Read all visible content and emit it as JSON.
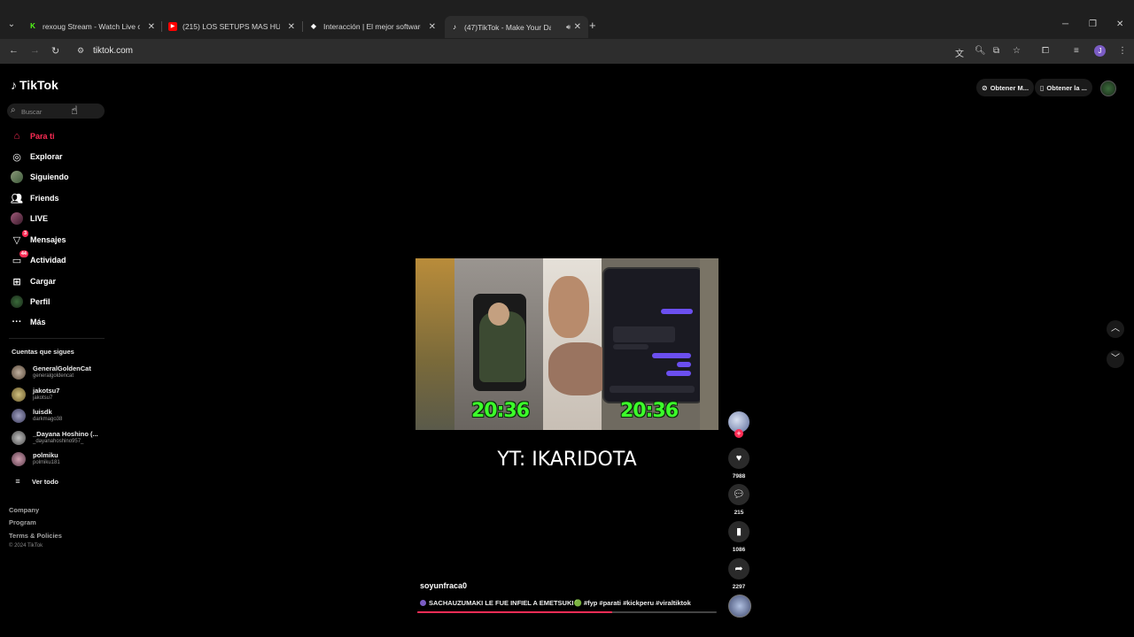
{
  "browser": {
    "tabs": [
      {
        "title": "rexoug Stream - Watch Live on",
        "favicon_color": "#53fc18",
        "favicon_letter": "K"
      },
      {
        "title": "(215) LOS SETUPS MAS HUMILD",
        "favicon_color": "#ff0000",
        "favicon_letter": "▶"
      },
      {
        "title": "Interacción | El mejor software",
        "favicon_color": "#ffffff",
        "favicon_letter": "◆"
      },
      {
        "title": "(47)TikTok - Make Your Day",
        "favicon_color": "#ffffff",
        "favicon_letter": "♪",
        "active": true
      }
    ],
    "url": "tiktok.com",
    "profile_letter": "J"
  },
  "sidebar": {
    "logo_text": "TikTok",
    "search_placeholder": "Buscar",
    "nav": [
      {
        "label": "Para ti",
        "icon": "home-icon",
        "active": true
      },
      {
        "label": "Explorar",
        "icon": "compass-icon"
      },
      {
        "label": "Siguiendo",
        "icon": "following-icon"
      },
      {
        "label": "Friends",
        "icon": "friends-icon"
      },
      {
        "label": "LIVE",
        "icon": "live-icon"
      },
      {
        "label": "Mensajes",
        "icon": "messages-icon",
        "badge": "3"
      },
      {
        "label": "Actividad",
        "icon": "activity-icon",
        "badge": "44"
      },
      {
        "label": "Cargar",
        "icon": "upload-icon"
      },
      {
        "label": "Perfil",
        "icon": "profile-icon"
      },
      {
        "label": "Más",
        "icon": "more-icon"
      }
    ],
    "following_title": "Cuentas que sigues",
    "following": [
      {
        "name": "GeneralGoldenCat",
        "handle": "generalgoldencat"
      },
      {
        "name": "jakotsu7",
        "handle": "jakotsu7"
      },
      {
        "name": "luisdk",
        "handle": "darkmago38"
      },
      {
        "name": "_Dayana Hoshino (...",
        "handle": "_dayanahoshino957_"
      },
      {
        "name": "polmiku",
        "handle": "polmiku181"
      }
    ],
    "see_all": "Ver todo",
    "footer": [
      "Company",
      "Program",
      "Terms & Policies"
    ],
    "copyright": "© 2024 TikTok"
  },
  "topright": {
    "pill1": "Obtener M...",
    "pill2": "Obtener la ..."
  },
  "video": {
    "timer_left": "20:36",
    "timer_right": "20:36",
    "overlay_text": "YT: IKARIDOTA",
    "author": "soyunfraca0",
    "caption": "SACHAUZUMAKI LE FUE INFIEL A EMETSUKI🟢 #fyp #parati #kickperu #viraltiktok",
    "progress": 0.65,
    "likes": "7988",
    "comments": "215",
    "saves": "1086",
    "shares": "2297"
  }
}
